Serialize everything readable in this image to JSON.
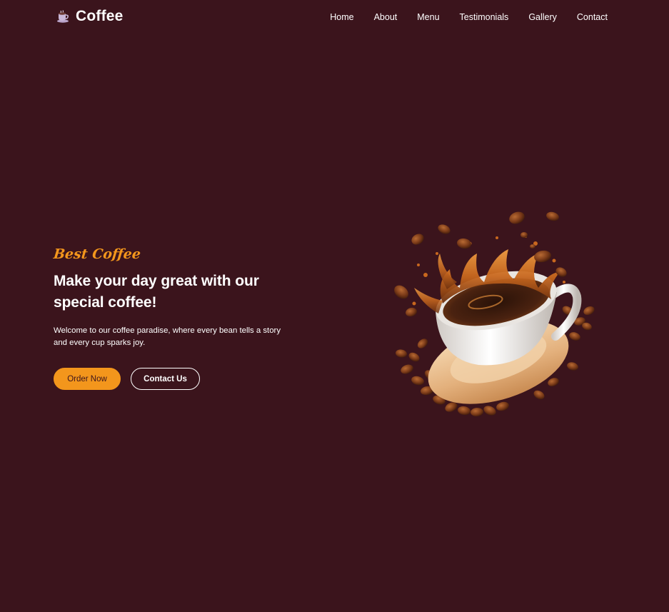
{
  "brand": {
    "name": "Coffee",
    "icon": "coffee-cup-icon"
  },
  "nav": {
    "items": [
      {
        "label": "Home"
      },
      {
        "label": "About"
      },
      {
        "label": "Menu"
      },
      {
        "label": "Testimonials"
      },
      {
        "label": "Gallery"
      },
      {
        "label": "Contact"
      }
    ]
  },
  "hero": {
    "subtitle": "Best Coffee",
    "title_line1": "Make your day great with our",
    "title_line2": "special coffee!",
    "description": "Welcome to our coffee paradise, where every bean tells a story and every cup sparks joy.",
    "buttons": {
      "order": "Order Now",
      "contact": "Contact Us"
    },
    "image": "coffee-cup-splash-illustration"
  },
  "colors": {
    "background": "#3b141c",
    "accent": "#f3961c",
    "text": "#ffffff"
  }
}
